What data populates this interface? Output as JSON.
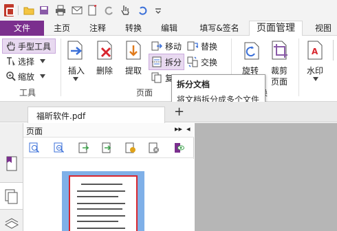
{
  "menu": {
    "file": "文件",
    "tabs": [
      "主页",
      "注释",
      "转换",
      "编辑",
      "填写&签名",
      "页面管理",
      "视图"
    ],
    "active_tab": "页面管理"
  },
  "ribbon": {
    "tools_group": {
      "hand": "手型工具",
      "select": "选择",
      "zoom": "缩放",
      "label": "工具"
    },
    "page_group": {
      "insert": "插入",
      "delete": "删除",
      "extract": "提取",
      "move": "移动",
      "split": "拆分",
      "copy_partial": "复",
      "replace": "替换",
      "swap": "交换",
      "label": "页面",
      "label_partial": "换"
    },
    "rotate": "旋转",
    "crop": "裁剪",
    "crop_2": "页面",
    "watermark": "水印"
  },
  "tooltip": {
    "title": "拆分文档",
    "description": "将文档拆分成多个文件"
  },
  "document_tab": {
    "name": "福昕软件.pdf",
    "close": "×",
    "add": "+"
  },
  "pages_panel": {
    "title": "页面",
    "nav_glyph": "▸▸",
    "collapse_glyph": "◂"
  },
  "colors": {
    "accent": "#7b2f8e",
    "selection": "#7fb0e8",
    "page_border": "#d8262e",
    "workspace": "#b6b6b6"
  }
}
